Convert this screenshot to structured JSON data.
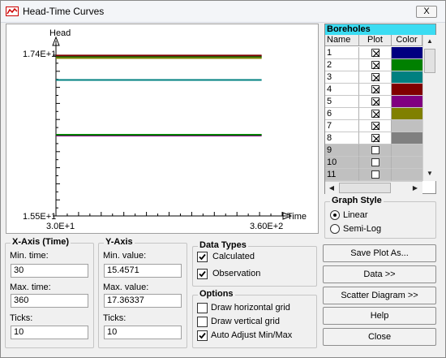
{
  "window": {
    "title": "Head-Time Curves",
    "close_label": "X"
  },
  "plot": {
    "y_axis_label": "Head",
    "x_axis_label": "Time",
    "y_max_label": "1.74E+1",
    "y_min_label": "1.55E+1",
    "x_min_label": "3.0E+1",
    "x_max_label": "3.60E+2"
  },
  "chart_data": {
    "type": "line",
    "xlabel": "Time",
    "ylabel": "Head",
    "xlim": [
      30,
      360
    ],
    "ylim": [
      15.4571,
      17.36337
    ],
    "grid": false,
    "series": [
      {
        "color": "#000080",
        "x": [
          30,
          330
        ],
        "y": [
          17.35,
          17.35
        ]
      },
      {
        "color": "#008000",
        "x": [
          30,
          330
        ],
        "y": [
          17.34,
          17.34
        ]
      },
      {
        "color": "#008080",
        "x": [
          30,
          330
        ],
        "y": [
          17.07,
          17.07
        ]
      },
      {
        "color": "#800000",
        "x": [
          30,
          330
        ],
        "y": [
          17.36,
          17.36
        ]
      },
      {
        "color": "#800080",
        "x": [
          30,
          330
        ],
        "y": [
          16.41,
          16.41
        ]
      },
      {
        "color": "#808000",
        "x": [
          30,
          330
        ],
        "y": [
          17.33,
          17.33
        ]
      },
      {
        "color": "#008000",
        "x": [
          30,
          330
        ],
        "y": [
          16.42,
          16.42
        ]
      }
    ]
  },
  "boreholes": {
    "title": "Boreholes",
    "columns": [
      "Name",
      "Plot",
      "Color"
    ],
    "rows": [
      {
        "name": "1",
        "plot": true,
        "color": "#000080",
        "enabled": true
      },
      {
        "name": "2",
        "plot": true,
        "color": "#008000",
        "enabled": true
      },
      {
        "name": "3",
        "plot": true,
        "color": "#008080",
        "enabled": true
      },
      {
        "name": "4",
        "plot": true,
        "color": "#800000",
        "enabled": true
      },
      {
        "name": "5",
        "plot": true,
        "color": "#800080",
        "enabled": true
      },
      {
        "name": "6",
        "plot": true,
        "color": "#808000",
        "enabled": true
      },
      {
        "name": "7",
        "plot": true,
        "color": "#c0c0c0",
        "enabled": true
      },
      {
        "name": "8",
        "plot": true,
        "color": "#808080",
        "enabled": true
      },
      {
        "name": "9",
        "plot": false,
        "color": "",
        "enabled": false
      },
      {
        "name": "10",
        "plot": false,
        "color": "",
        "enabled": false
      },
      {
        "name": "11",
        "plot": false,
        "color": "",
        "enabled": false
      }
    ]
  },
  "graph_style": {
    "title": "Graph Style",
    "linear_label": "Linear",
    "semilog_label": "Semi-Log",
    "selected": "Linear"
  },
  "x_axis": {
    "title": "X-Axis (Time)",
    "min_label": "Min. time:",
    "min_value": "30",
    "max_label": "Max. time:",
    "max_value": "360",
    "ticks_label": "Ticks:",
    "ticks_value": "10"
  },
  "y_axis": {
    "title": "Y-Axis",
    "min_label": "Min. value:",
    "min_value": "15.4571",
    "max_label": "Max. value:",
    "max_value": "17.36337",
    "ticks_label": "Ticks:",
    "ticks_value": "10"
  },
  "data_types": {
    "title": "Data Types",
    "calculated_label": "Calculated",
    "calculated_checked": true,
    "observation_label": "Observation",
    "observation_checked": true
  },
  "options": {
    "title": "Options",
    "hgrid_label": "Draw horizontal grid",
    "hgrid_checked": false,
    "vgrid_label": "Draw vertical grid",
    "vgrid_checked": false,
    "auto_label": "Auto Adjust Min/Max",
    "auto_checked": true
  },
  "buttons": {
    "save_plot": "Save Plot As...",
    "data": "Data >>",
    "scatter": "Scatter Diagram >>",
    "help": "Help",
    "close": "Close"
  }
}
